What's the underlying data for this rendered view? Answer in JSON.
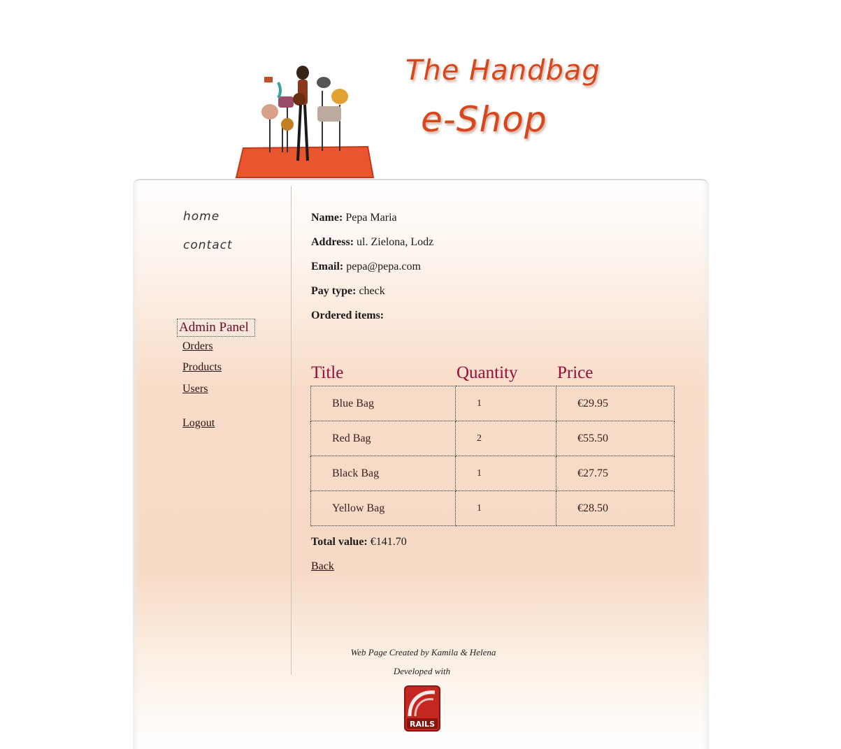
{
  "header": {
    "brand_line_1": "The Handbag",
    "brand_line_2": "e-Shop",
    "banner_icon": "shopping-girl-illustration"
  },
  "sidebar": {
    "nav": [
      "home",
      "contact"
    ],
    "admin_title": "Admin Panel",
    "links": [
      "Orders",
      "Products",
      "Users"
    ],
    "logout": "Logout"
  },
  "order": {
    "name_label": "Name:",
    "name": "Pepa Maria",
    "address_label": "Address:",
    "address": "ul. Zielona, Lodz",
    "email_label": "Email:",
    "email": "pepa@pepa.com",
    "pay_label": "Pay type:",
    "pay_type": "check",
    "items_label": "Ordered items:",
    "columns": [
      "Title",
      "Quantity",
      "Price"
    ],
    "items": [
      {
        "title": "Blue Bag",
        "quantity": "1",
        "price": "€29.95"
      },
      {
        "title": "Red Bag",
        "quantity": "2",
        "price": "€55.50"
      },
      {
        "title": "Black Bag",
        "quantity": "1",
        "price": "€27.75"
      },
      {
        "title": "Yellow Bag",
        "quantity": "1",
        "price": "€28.50"
      }
    ],
    "total_label": "Total value:",
    "total": "€141.70",
    "back": "Back"
  },
  "footer": {
    "credit": "Web Page Created by Kamila & Helena",
    "developed": "Developed with",
    "logo_text": "RAILS"
  },
  "colors": {
    "accent": "#9a0b3b",
    "brand": "#d8471c",
    "panel_peach": "#f8dcc7"
  }
}
